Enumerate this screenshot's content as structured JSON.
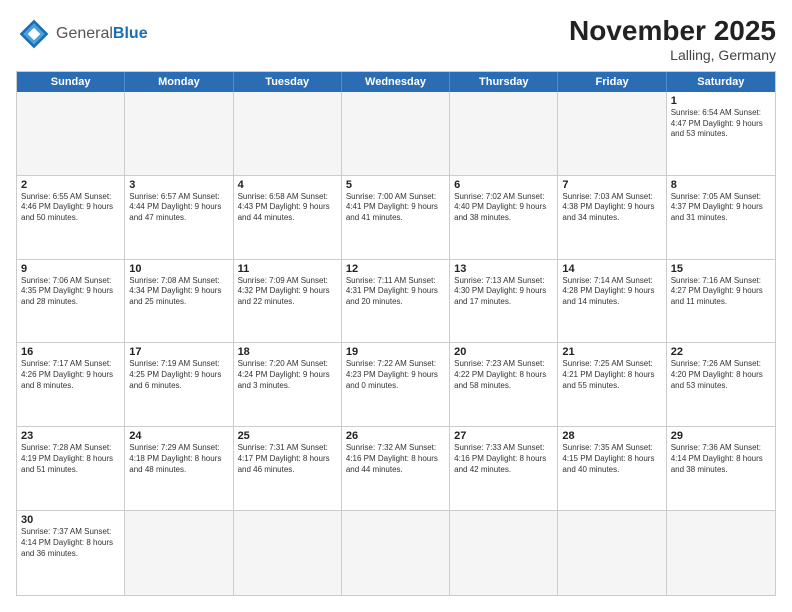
{
  "header": {
    "logo_general": "General",
    "logo_blue": "Blue",
    "month_year": "November 2025",
    "location": "Lalling, Germany"
  },
  "day_headers": [
    "Sunday",
    "Monday",
    "Tuesday",
    "Wednesday",
    "Thursday",
    "Friday",
    "Saturday"
  ],
  "weeks": [
    [
      {
        "num": "",
        "info": "",
        "empty": true
      },
      {
        "num": "",
        "info": "",
        "empty": true
      },
      {
        "num": "",
        "info": "",
        "empty": true
      },
      {
        "num": "",
        "info": "",
        "empty": true
      },
      {
        "num": "",
        "info": "",
        "empty": true
      },
      {
        "num": "",
        "info": "",
        "empty": true
      },
      {
        "num": "1",
        "info": "Sunrise: 6:54 AM\nSunset: 4:47 PM\nDaylight: 9 hours\nand 53 minutes.",
        "empty": false
      }
    ],
    [
      {
        "num": "2",
        "info": "Sunrise: 6:55 AM\nSunset: 4:46 PM\nDaylight: 9 hours\nand 50 minutes.",
        "empty": false
      },
      {
        "num": "3",
        "info": "Sunrise: 6:57 AM\nSunset: 4:44 PM\nDaylight: 9 hours\nand 47 minutes.",
        "empty": false
      },
      {
        "num": "4",
        "info": "Sunrise: 6:58 AM\nSunset: 4:43 PM\nDaylight: 9 hours\nand 44 minutes.",
        "empty": false
      },
      {
        "num": "5",
        "info": "Sunrise: 7:00 AM\nSunset: 4:41 PM\nDaylight: 9 hours\nand 41 minutes.",
        "empty": false
      },
      {
        "num": "6",
        "info": "Sunrise: 7:02 AM\nSunset: 4:40 PM\nDaylight: 9 hours\nand 38 minutes.",
        "empty": false
      },
      {
        "num": "7",
        "info": "Sunrise: 7:03 AM\nSunset: 4:38 PM\nDaylight: 9 hours\nand 34 minutes.",
        "empty": false
      },
      {
        "num": "8",
        "info": "Sunrise: 7:05 AM\nSunset: 4:37 PM\nDaylight: 9 hours\nand 31 minutes.",
        "empty": false
      }
    ],
    [
      {
        "num": "9",
        "info": "Sunrise: 7:06 AM\nSunset: 4:35 PM\nDaylight: 9 hours\nand 28 minutes.",
        "empty": false
      },
      {
        "num": "10",
        "info": "Sunrise: 7:08 AM\nSunset: 4:34 PM\nDaylight: 9 hours\nand 25 minutes.",
        "empty": false
      },
      {
        "num": "11",
        "info": "Sunrise: 7:09 AM\nSunset: 4:32 PM\nDaylight: 9 hours\nand 22 minutes.",
        "empty": false
      },
      {
        "num": "12",
        "info": "Sunrise: 7:11 AM\nSunset: 4:31 PM\nDaylight: 9 hours\nand 20 minutes.",
        "empty": false
      },
      {
        "num": "13",
        "info": "Sunrise: 7:13 AM\nSunset: 4:30 PM\nDaylight: 9 hours\nand 17 minutes.",
        "empty": false
      },
      {
        "num": "14",
        "info": "Sunrise: 7:14 AM\nSunset: 4:28 PM\nDaylight: 9 hours\nand 14 minutes.",
        "empty": false
      },
      {
        "num": "15",
        "info": "Sunrise: 7:16 AM\nSunset: 4:27 PM\nDaylight: 9 hours\nand 11 minutes.",
        "empty": false
      }
    ],
    [
      {
        "num": "16",
        "info": "Sunrise: 7:17 AM\nSunset: 4:26 PM\nDaylight: 9 hours\nand 8 minutes.",
        "empty": false
      },
      {
        "num": "17",
        "info": "Sunrise: 7:19 AM\nSunset: 4:25 PM\nDaylight: 9 hours\nand 6 minutes.",
        "empty": false
      },
      {
        "num": "18",
        "info": "Sunrise: 7:20 AM\nSunset: 4:24 PM\nDaylight: 9 hours\nand 3 minutes.",
        "empty": false
      },
      {
        "num": "19",
        "info": "Sunrise: 7:22 AM\nSunset: 4:23 PM\nDaylight: 9 hours\nand 0 minutes.",
        "empty": false
      },
      {
        "num": "20",
        "info": "Sunrise: 7:23 AM\nSunset: 4:22 PM\nDaylight: 8 hours\nand 58 minutes.",
        "empty": false
      },
      {
        "num": "21",
        "info": "Sunrise: 7:25 AM\nSunset: 4:21 PM\nDaylight: 8 hours\nand 55 minutes.",
        "empty": false
      },
      {
        "num": "22",
        "info": "Sunrise: 7:26 AM\nSunset: 4:20 PM\nDaylight: 8 hours\nand 53 minutes.",
        "empty": false
      }
    ],
    [
      {
        "num": "23",
        "info": "Sunrise: 7:28 AM\nSunset: 4:19 PM\nDaylight: 8 hours\nand 51 minutes.",
        "empty": false
      },
      {
        "num": "24",
        "info": "Sunrise: 7:29 AM\nSunset: 4:18 PM\nDaylight: 8 hours\nand 48 minutes.",
        "empty": false
      },
      {
        "num": "25",
        "info": "Sunrise: 7:31 AM\nSunset: 4:17 PM\nDaylight: 8 hours\nand 46 minutes.",
        "empty": false
      },
      {
        "num": "26",
        "info": "Sunrise: 7:32 AM\nSunset: 4:16 PM\nDaylight: 8 hours\nand 44 minutes.",
        "empty": false
      },
      {
        "num": "27",
        "info": "Sunrise: 7:33 AM\nSunset: 4:16 PM\nDaylight: 8 hours\nand 42 minutes.",
        "empty": false
      },
      {
        "num": "28",
        "info": "Sunrise: 7:35 AM\nSunset: 4:15 PM\nDaylight: 8 hours\nand 40 minutes.",
        "empty": false
      },
      {
        "num": "29",
        "info": "Sunrise: 7:36 AM\nSunset: 4:14 PM\nDaylight: 8 hours\nand 38 minutes.",
        "empty": false
      }
    ],
    [
      {
        "num": "30",
        "info": "Sunrise: 7:37 AM\nSunset: 4:14 PM\nDaylight: 8 hours\nand 36 minutes.",
        "empty": false
      },
      {
        "num": "",
        "info": "",
        "empty": true
      },
      {
        "num": "",
        "info": "",
        "empty": true
      },
      {
        "num": "",
        "info": "",
        "empty": true
      },
      {
        "num": "",
        "info": "",
        "empty": true
      },
      {
        "num": "",
        "info": "",
        "empty": true
      },
      {
        "num": "",
        "info": "",
        "empty": true
      }
    ]
  ]
}
